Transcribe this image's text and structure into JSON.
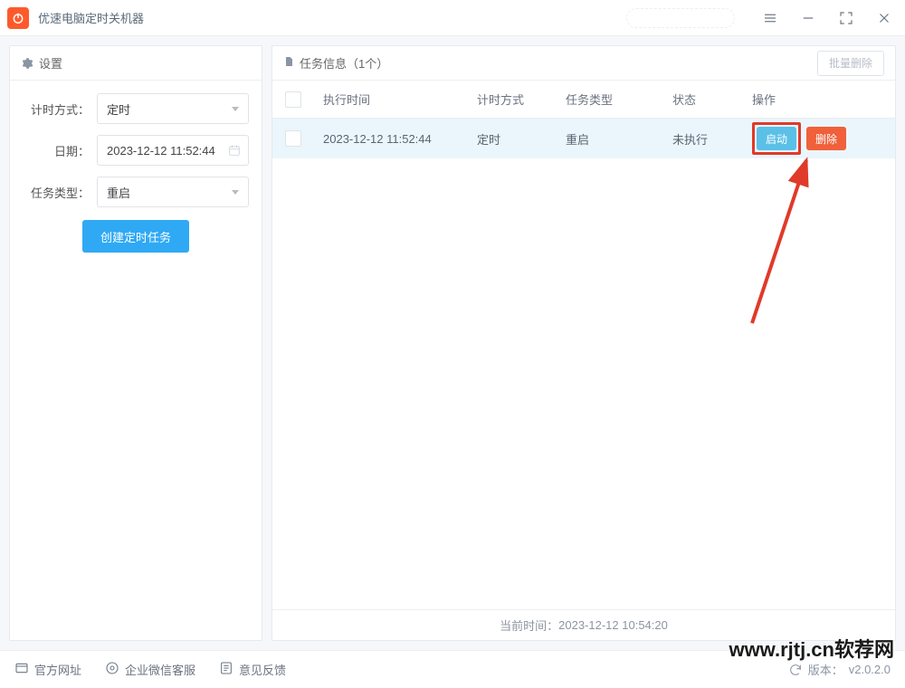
{
  "title": "优速电脑定时关机器",
  "titlebar_icons": {
    "menu": "menu-icon",
    "minimize": "minimize-icon",
    "maximize": "fullscreen-icon",
    "close": "close-icon"
  },
  "sidebar": {
    "header": "设置",
    "form": {
      "method_label": "计时方式：",
      "method_value": "定时",
      "date_label": "日期：",
      "date_value": "2023-12-12 11:52:44",
      "type_label": "任务类型：",
      "type_value": "重启",
      "create_button": "创建定时任务"
    }
  },
  "content": {
    "title": "任务信息（1个）",
    "batch_delete": "批量删除",
    "columns": {
      "time": "执行时间",
      "method": "计时方式",
      "type": "任务类型",
      "status": "状态",
      "ops": "操作"
    },
    "rows": [
      {
        "time": "2023-12-12 11:52:44",
        "method": "定时",
        "type": "重启",
        "status": "未执行",
        "start": "启动",
        "delete": "删除"
      }
    ],
    "current_time_label": "当前时间：",
    "current_time_value": "2023-12-12 10:54:20"
  },
  "footer": {
    "official_site": "官方网址",
    "wechat_support": "企业微信客服",
    "feedback": "意见反馈",
    "version_label": "版本：",
    "version_value": "v2.0.2.0"
  },
  "watermark": "www.rjtj.cn软荐网"
}
